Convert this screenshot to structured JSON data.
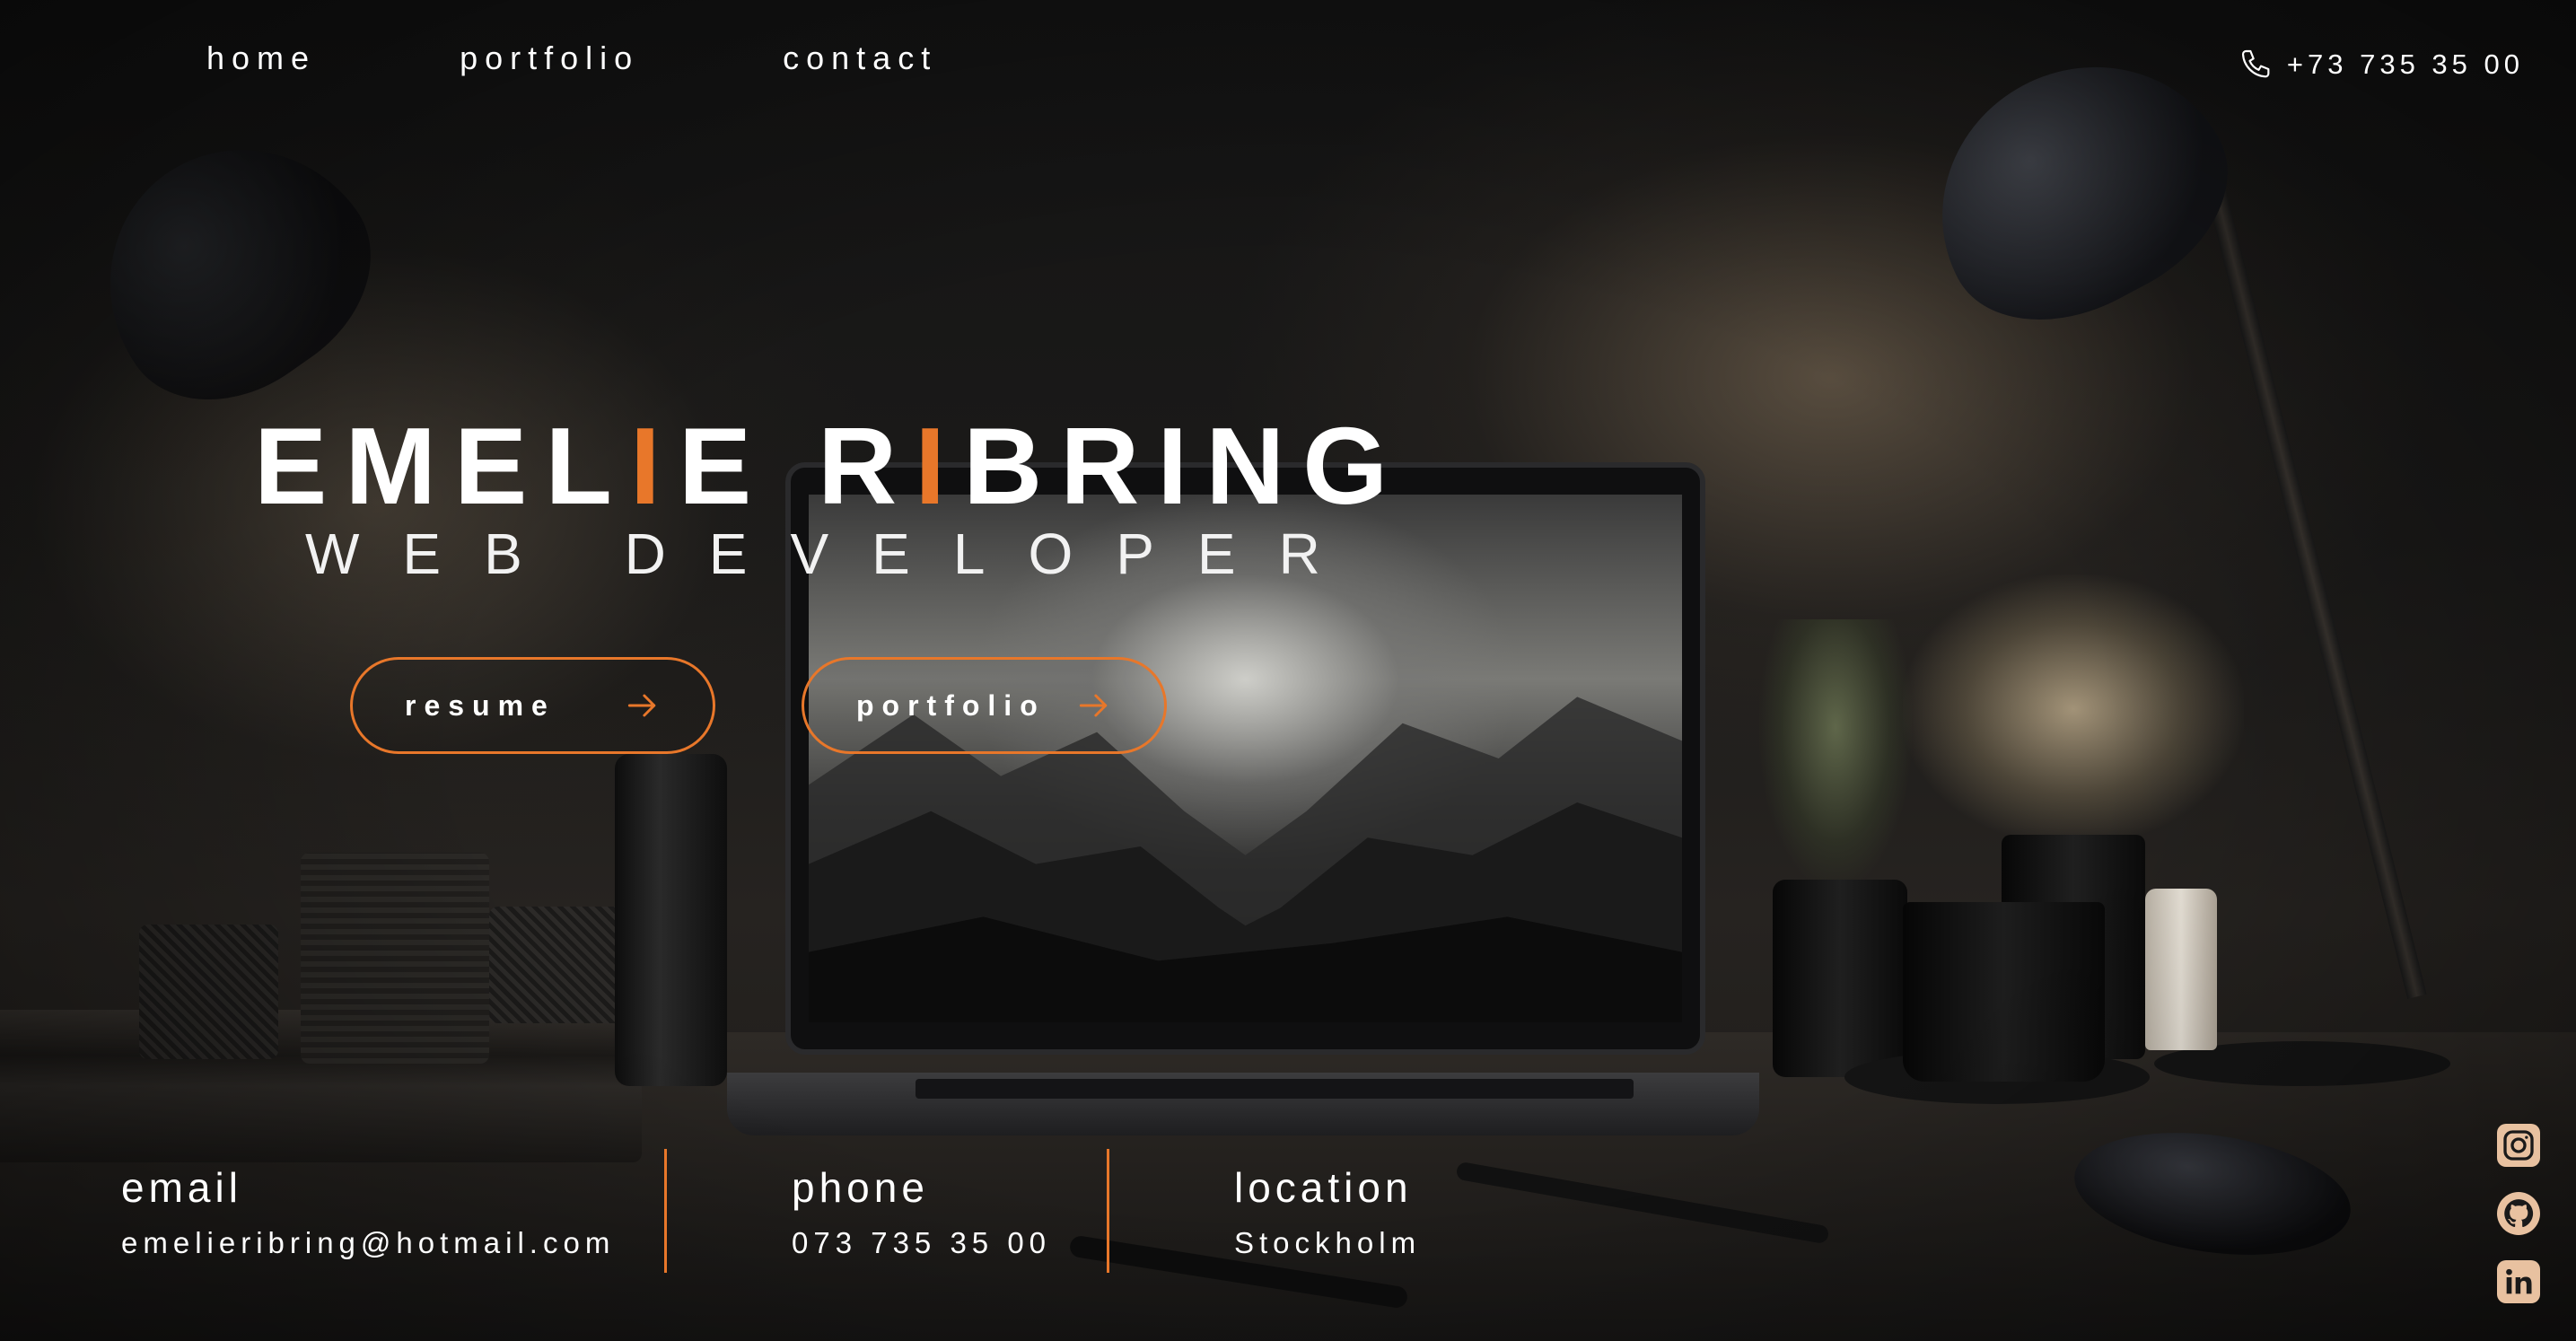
{
  "nav": {
    "items": [
      {
        "label": "home"
      },
      {
        "label": "portfolio"
      },
      {
        "label": "contact"
      }
    ]
  },
  "header": {
    "phone_icon": "phone-icon",
    "phone": "+73 735 35 00"
  },
  "hero": {
    "name_part1": "EMEL",
    "name_accent1": "I",
    "name_part2": "E R",
    "name_accent2": "I",
    "name_part3": "BRING",
    "role": "WEB DEVELOPER"
  },
  "buttons": {
    "resume_label": "resume",
    "portfolio_label": "portfolio",
    "arrow_icon": "arrow-right-icon"
  },
  "contact": {
    "email_title": "email",
    "email_value": "emelieribring@hotmail.com",
    "phone_title": "phone",
    "phone_value": "073 735 35 00",
    "location_title": "location",
    "location_value": "Stockholm"
  },
  "social": [
    {
      "icon": "instagram-icon"
    },
    {
      "icon": "github-icon"
    },
    {
      "icon": "linkedin-icon"
    }
  ],
  "colors": {
    "accent": "#e8772a",
    "social_icon_bg": "#e8c1a0",
    "text": "#ffffff"
  }
}
